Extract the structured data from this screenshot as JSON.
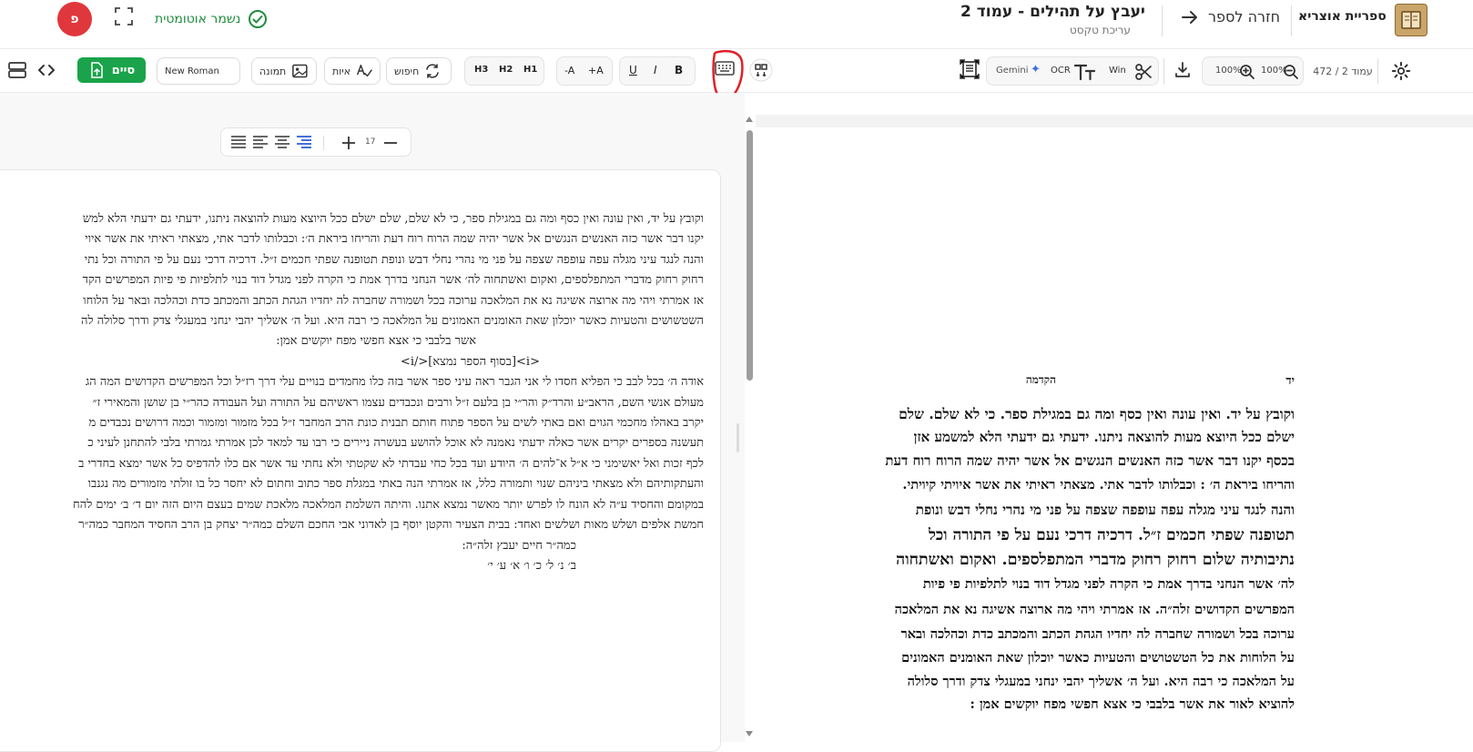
{
  "header": {
    "app_name": "ספריית אוצריא",
    "back_label": "חזרה לספר",
    "doc_title": "יעבץ על תהילים - עמוד 2",
    "doc_subtitle": "עריכת טקסט",
    "autosave_label": "נשמר אוטומטית",
    "avatar_letter": "פ"
  },
  "toolbar": {
    "page_indicator": "עמוד 2 / 472",
    "zoom_a": "100%",
    "zoom_b": "100%",
    "win_label": "Win",
    "ocr_label": "OCR",
    "gemini_label": "Gemini",
    "bold": "B",
    "italic": "I",
    "underline": "U",
    "font_plus": "+A",
    "font_minus": "-A",
    "h1": "H1",
    "h2": "H2",
    "h3": "H3",
    "search_label": "חיפוש",
    "letters_label": "איות",
    "image_label": "תמונה",
    "font_name": "New Roman",
    "finish_label": "סיים"
  },
  "format_bar": {
    "font_size": "17"
  },
  "editor": {
    "lines": [
      "וקובץ על יד, ואין עונה ואין כסף ומה גם במגילת ספר, כי לא שלם, שלם ישלם ככל היוצא מעות להוצאה ניתנו, ידעתי גם ידעתי הלא למש",
      "יקנו דבר אשר כזה האנשים הנגשים אל אשר יהיה שמה הרוח רוח דעת והריחו ביראת ה׳: וכבלותו לדבר אתי, מצאתי ראיתי את אשר איוי",
      "והנה לנגד עיני מגלה עפה עופפה שצפה על פני מי נהרי נחלי דבש ונופת תטופנה שפתי חכמים ז״ל. דרכיה דרכי נעם על פי התורה וכל נתי",
      "רחוק רחוק מדברי המתפלספים, ואקום ואשתחוה לה׳ אשר הנחני בדרך אמת כי הקרה לפני מגדל דוד בנוי לתלפיות פי פיות המפרשים הקד",
      "אז אמרתי ויהי מה ארוצה אשיגה נא את המלאכה ערוכה בכל ושמורה שחברה לה יחדיו הגהת הכתב והמכתב כדת וכהלכה ובאר על הלוחו",
      "השטשושים והטעיות כאשר יוכלון שאת האומנים האמונים על המלאכה כי רבה היא. ועל ה׳ אשליך יהבי ינחני במעגלי צדק ודרך סלולה לה",
      "אשר בלבבי כי אצא חפשי מפח יוקשים אמן:",
      "<i>[בסוף הספר נמצא]</i>",
      "אודה ה׳ בכל לבב כי הפליא חסדו לי אני הגבר ראה עיני ספר אשר בזה כלו מחמדים בנויים עלי דרך רז״ל וכל המפרשים הקדושים המה הג",
      "מעולם אנשי השם, הראב״ע והרד״ק והר״י בן בלעם ז״ל ורבים ונכבדים עצמו ראשיהם על התורה ועל העבודה כהר״י בן שושן והמאירי ז״",
      "יקרב באהלו מחכמי הגוים ואם באתי לשים על הספר פתוח חותם תבנית כונת הרב המחבר ז״ל בכל מזמור ומזמור וכמה דרושים נכבדים מ",
      "תעשנה בספרים יקרים אשר כאלה ידעתי נאמנה לא אוכל להושע בעשרה ניירים כי רבו עד למאד לכן אמרתי גמרתי בלבי להתחנן לעיני כ",
      "לכף זכות ואל יאשימני כי א״ל א־להים ה׳ היודע ועד בכל כחי עבדתי לא שקטתי ולא נחתי עד אשר אם כלו להדפיס כל אשר ימצא בחדרי ב",
      "והעתקותיהם ולא מצאתי ביניהם שנוי ותמורה כלל, אז אמרתי הנה באתי במגלת ספר כתוב וחתום לא יחסר כל בו זולתי מזמורים מה נגנבו",
      "במקומם והחסיד ע״ה לא הונח לו לפרש יותר מאשר נמצא אתנו. והיתה השלמת המלאכה מלאכת שמים בעצם היום הזה יום ד׳ ב׳ ימים להח",
      "חמשת אלפים ושלש מאות ושלשים ואחד: בבית הצעיר והקטן יוסף בן לאדוני אבי החכם השלם כמה״ר יצחק בן הרב החסיד המחבר כמה״ר",
      "כמה״ר חיים יעבץ זלה״ה:",
      "ב׳ נ׳ ל׳ כ׳     ו׳ א׳ ע׳ י׳"
    ]
  },
  "scan": {
    "header_right": "יד",
    "header_center": "הקדמה",
    "lines": [
      "וקובץ על יד. ואין עונה ואין כסף ומה גם במגילת ספר. כי לא שלם. שלם",
      "ישלם ככל היוצא מעות להוצאה ניתנו. ידעתי גם ידעתי הלא למשמע אזן",
      "בכסף יקנו דבר אשר כזה האנשים הנגשים אל אשר יהיה שמה הרוח רוח דעת",
      "והריחו ביראת ה׳ : וכבלותו לדבר אתי. מצאתי ראיתי את אשר איויתי קיויתי.",
      "והנה לנגד עיני מגלה עפה עופפה שצפה על פני מי נהרי נחלי דבש ונופת",
      "תטופנה שפתי חכמים ז״ל. דרכיה דרכי נעם על פי התורה וכל",
      "נתיבותיה שלום רחוק רחוק מדברי המתפלספים. ואקום ואשתחוה",
      "לה׳ אשר הנחני בדרך אמת כי הקרה לפני מגדל דוד בנוי לתלפיות פי פיות",
      "המפרשים הקדושים זלה״ה. אז אמרתי ויהי מה ארוצה אשיגה נא את המלאכה",
      "ערוכה בכל ושמורה שחברה לה יחדיו הגהת הכתב והמכתב כדת וכהלכה ובאר",
      "על הלוחות את כל הטשטושים והטעיות כאשר יוכלון שאת האומנים האמונים",
      "על המלאכה כי רבה היא. ועל ה׳ אשליך יהבי ינחני במעגלי צדק ודרך סלולה",
      "להוציא לאור את אשר בלבבי כי אצא חפשי מפח יוקשים אמן :"
    ]
  }
}
